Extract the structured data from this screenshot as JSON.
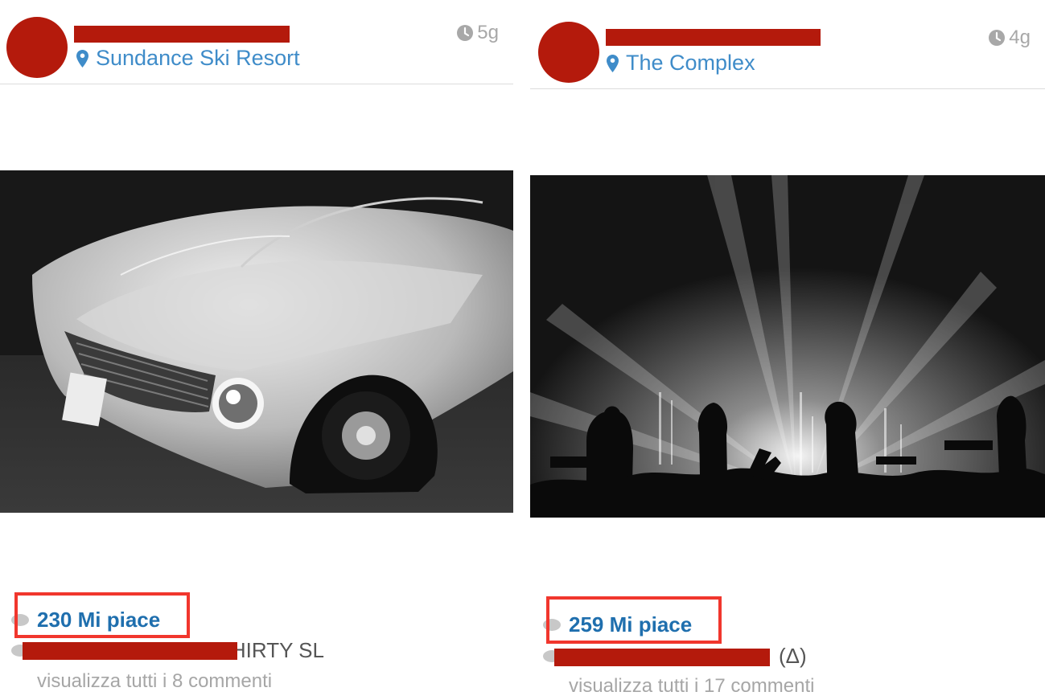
{
  "posts": [
    {
      "location": "Sundance Ski Resort",
      "time": "5g",
      "image": "vintage-car-photo",
      "likes": "230 Mi piace",
      "caption_tail": "THIRTY SL",
      "comments": "visualizza tutti i 8 commenti"
    },
    {
      "location": "The Complex",
      "time": "4g",
      "image": "concert-stage-photo",
      "likes": "259 Mi piace",
      "caption_tail": "(Δ)",
      "comments": "visualizza tutti i 17 commenti"
    }
  ],
  "colors": {
    "accent": "#3f8cc9",
    "likes": "#1f6fae",
    "redaction": "#b41a0c",
    "highlight": "#f1362d",
    "muted": "#a6a6a6"
  },
  "icons": [
    "location-pin-icon",
    "clock-icon",
    "heart-icon",
    "comment-icon"
  ]
}
